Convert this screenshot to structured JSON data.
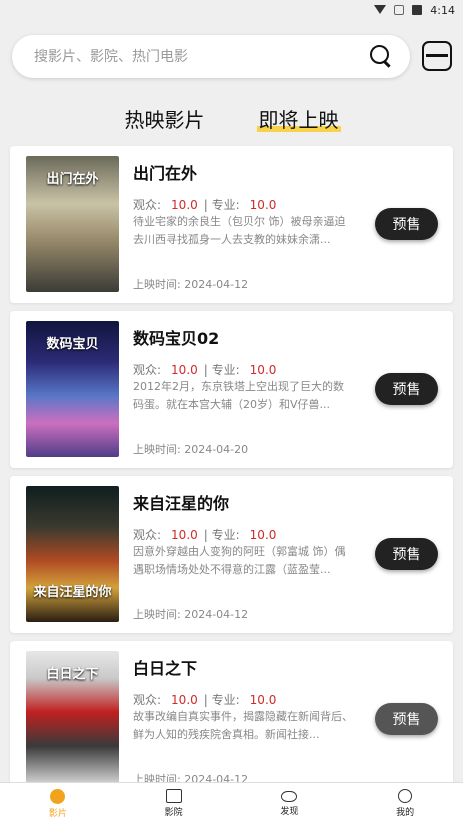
{
  "status": {
    "time": "4:14"
  },
  "search": {
    "placeholder": "搜影片、影院、热门电影"
  },
  "tabs": [
    {
      "label": "热映影片"
    },
    {
      "label": "即将上映"
    }
  ],
  "labels": {
    "audience": "观众:",
    "pro": "| 专业:",
    "release": "上映时间:"
  },
  "movies": [
    {
      "title": "出门在外",
      "audience_score": "10.0",
      "pro_score": "10.0",
      "desc": "待业宅家的余良生（包贝尔 饰）被母亲逼迫去川西寻找孤身一人去支教的妹妹余潇...",
      "release_date": "2024-04-12",
      "button": "预售",
      "poster_text": "出门在外"
    },
    {
      "title": "数码宝贝02",
      "audience_score": "10.0",
      "pro_score": "10.0",
      "desc": "2012年2月，东京铁塔上空出现了巨大的数码蛋。就在本宫大辅（20岁）和V仔兽...",
      "release_date": "2024-04-20",
      "button": "预售",
      "poster_text": "数码宝贝"
    },
    {
      "title": "来自汪星的你",
      "audience_score": "10.0",
      "pro_score": "10.0",
      "desc": "因意外穿越由人变狗的阿旺（郭富城 饰）偶遇职场情场处处不得意的江露（蓝盈莹...",
      "release_date": "2024-04-12",
      "button": "预售",
      "poster_text": "来自汪星的你"
    },
    {
      "title": "白日之下",
      "audience_score": "10.0",
      "pro_score": "10.0",
      "desc": "故事改编自真实事件，揭露隐藏在新闻背后、鲜为人知的残疾院舍真相。新闻社接...",
      "release_date": "2024-04-12",
      "button": "预售",
      "poster_text": "白日之下"
    }
  ],
  "nav": [
    {
      "label": "影片",
      "icon": "film-icon"
    },
    {
      "label": "影院",
      "icon": "cinema-icon"
    },
    {
      "label": "发现",
      "icon": "eye-icon"
    },
    {
      "label": "我的",
      "icon": "user-icon"
    }
  ]
}
